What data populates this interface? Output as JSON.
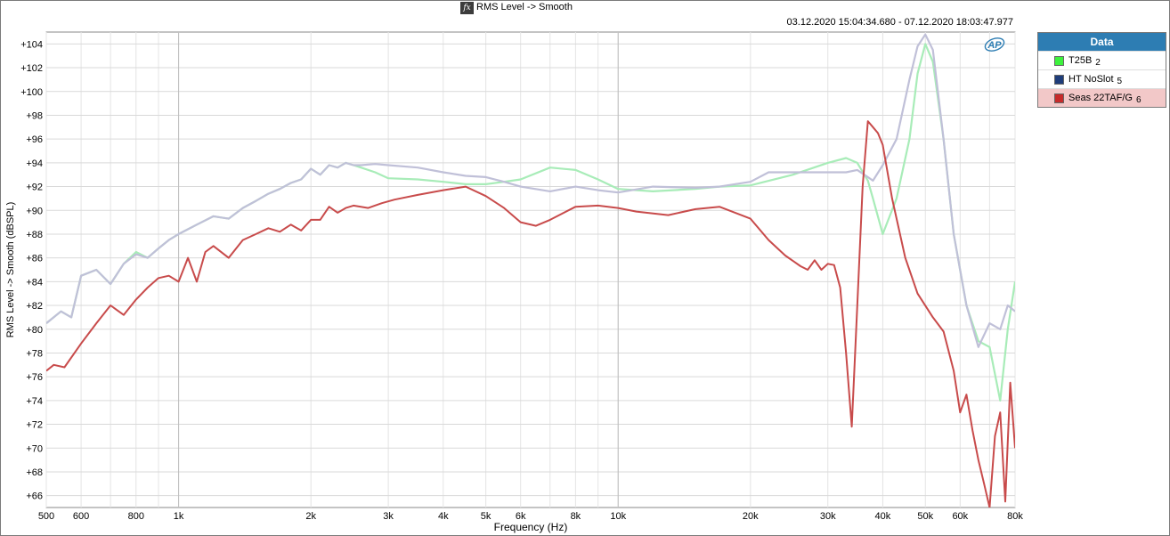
{
  "window": {
    "title": "RMS Level -> Smooth",
    "timestamp": "03.12.2020 15:04:34.680 - 07.12.2020 18:03:47.977"
  },
  "logo": {
    "text": "AP"
  },
  "legend": {
    "header": "Data",
    "items": [
      {
        "label": "T25B",
        "num": "2",
        "color": "#3df23d",
        "selected": false
      },
      {
        "label": "HT NoSlot",
        "num": "5",
        "color": "#1f3d7a",
        "selected": false
      },
      {
        "label": "Seas 22TAF/G",
        "num": "6",
        "color": "#c62b2b",
        "selected": true
      }
    ]
  },
  "chart_data": {
    "type": "line",
    "title": "RMS Level -> Smooth",
    "xlabel": "Frequency (Hz)",
    "ylabel": "RMS Level -> Smooth (dBSPL)",
    "xscale": "log",
    "xlim": [
      500,
      80000
    ],
    "ylim": [
      65,
      105
    ],
    "grid": true,
    "legend_position": "right",
    "x_ticks": [
      {
        "v": 500,
        "label": "500"
      },
      {
        "v": 600,
        "label": "600"
      },
      {
        "v": 800,
        "label": "800"
      },
      {
        "v": 1000,
        "label": "1k"
      },
      {
        "v": 2000,
        "label": "2k"
      },
      {
        "v": 3000,
        "label": "3k"
      },
      {
        "v": 4000,
        "label": "4k"
      },
      {
        "v": 5000,
        "label": "5k"
      },
      {
        "v": 6000,
        "label": "6k"
      },
      {
        "v": 8000,
        "label": "8k"
      },
      {
        "v": 10000,
        "label": "10k"
      },
      {
        "v": 20000,
        "label": "20k"
      },
      {
        "v": 30000,
        "label": "30k"
      },
      {
        "v": 40000,
        "label": "40k"
      },
      {
        "v": 50000,
        "label": "50k"
      },
      {
        "v": 60000,
        "label": "60k"
      },
      {
        "v": 80000,
        "label": "80k"
      }
    ],
    "y_ticks": [
      {
        "v": 66,
        "label": "+66"
      },
      {
        "v": 68,
        "label": "+68"
      },
      {
        "v": 70,
        "label": "+70"
      },
      {
        "v": 72,
        "label": "+72"
      },
      {
        "v": 74,
        "label": "+74"
      },
      {
        "v": 76,
        "label": "+76"
      },
      {
        "v": 78,
        "label": "+78"
      },
      {
        "v": 80,
        "label": "+80"
      },
      {
        "v": 82,
        "label": "+82"
      },
      {
        "v": 84,
        "label": "+84"
      },
      {
        "v": 86,
        "label": "+86"
      },
      {
        "v": 88,
        "label": "+88"
      },
      {
        "v": 90,
        "label": "+90"
      },
      {
        "v": 92,
        "label": "+92"
      },
      {
        "v": 94,
        "label": "+94"
      },
      {
        "v": 96,
        "label": "+96"
      },
      {
        "v": 98,
        "label": "+98"
      },
      {
        "v": 100,
        "label": "+100"
      },
      {
        "v": 102,
        "label": "+102"
      },
      {
        "v": 104,
        "label": "+104"
      }
    ],
    "series": [
      {
        "name": "T25B",
        "color": "#a8ecb8",
        "x": [
          500,
          540,
          570,
          600,
          650,
          700,
          750,
          800,
          850,
          900,
          950,
          1000,
          1100,
          1200,
          1300,
          1400,
          1500,
          1600,
          1700,
          1800,
          1900,
          2000,
          2100,
          2200,
          2300,
          2400,
          2500,
          2600,
          2800,
          3000,
          3500,
          4000,
          4500,
          5000,
          5500,
          6000,
          7000,
          8000,
          9000,
          10000,
          12000,
          15000,
          17000,
          20000,
          25000,
          30000,
          33000,
          35000,
          37000,
          38000,
          40000,
          43000,
          46000,
          48000,
          50000,
          52000,
          55000,
          58000,
          62000,
          66000,
          70000,
          74000,
          77000,
          80000
        ],
        "y": [
          80.5,
          81.5,
          81.0,
          84.5,
          85.0,
          83.8,
          85.5,
          86.5,
          86.0,
          86.8,
          87.5,
          88.0,
          88.8,
          89.5,
          89.3,
          90.2,
          90.8,
          91.4,
          91.8,
          92.3,
          92.6,
          93.5,
          93.0,
          93.8,
          93.6,
          94.0,
          93.8,
          93.6,
          93.2,
          92.7,
          92.6,
          92.4,
          92.2,
          92.2,
          92.4,
          92.6,
          93.6,
          93.4,
          92.6,
          91.8,
          91.6,
          91.8,
          92.0,
          92.1,
          93.0,
          94.0,
          94.4,
          94.0,
          92.5,
          91.0,
          88.0,
          91.0,
          96.0,
          101.5,
          104.0,
          102.5,
          96.0,
          88.0,
          82.0,
          79.0,
          78.5,
          74.0,
          80.0,
          84.0
        ]
      },
      {
        "name": "HT NoSlot",
        "color": "#c0c0d8",
        "x": [
          500,
          540,
          570,
          600,
          650,
          700,
          750,
          800,
          850,
          900,
          950,
          1000,
          1100,
          1200,
          1300,
          1400,
          1500,
          1600,
          1700,
          1800,
          1900,
          2000,
          2100,
          2200,
          2300,
          2400,
          2500,
          2600,
          2800,
          3000,
          3500,
          4000,
          4500,
          5000,
          5500,
          6000,
          7000,
          8000,
          9000,
          10000,
          12000,
          15000,
          17000,
          20000,
          22000,
          25000,
          30000,
          33000,
          35000,
          37000,
          38000,
          40000,
          43000,
          46000,
          48000,
          50000,
          52000,
          55000,
          58000,
          62000,
          66000,
          70000,
          74000,
          77000,
          80000
        ],
        "y": [
          80.5,
          81.5,
          81.0,
          84.5,
          85.0,
          83.8,
          85.5,
          86.3,
          86.0,
          86.8,
          87.5,
          88.0,
          88.8,
          89.5,
          89.3,
          90.2,
          90.8,
          91.4,
          91.8,
          92.3,
          92.6,
          93.5,
          93.0,
          93.8,
          93.6,
          94.0,
          93.8,
          93.8,
          93.9,
          93.8,
          93.6,
          93.2,
          92.9,
          92.8,
          92.4,
          92.0,
          91.6,
          92.0,
          91.7,
          91.5,
          92.0,
          91.9,
          92.0,
          92.4,
          93.2,
          93.2,
          93.2,
          93.2,
          93.4,
          92.8,
          92.5,
          93.8,
          96.0,
          101.0,
          103.8,
          104.8,
          103.5,
          96.0,
          88.0,
          82.0,
          78.5,
          80.5,
          80.0,
          82.0,
          81.5
        ]
      },
      {
        "name": "Seas 22TAF/G",
        "color": "#c84b4b",
        "x": [
          500,
          520,
          550,
          600,
          650,
          700,
          750,
          800,
          850,
          900,
          950,
          1000,
          1050,
          1100,
          1150,
          1200,
          1300,
          1400,
          1500,
          1600,
          1700,
          1800,
          1900,
          2000,
          2100,
          2200,
          2300,
          2400,
          2500,
          2700,
          2900,
          3100,
          3500,
          4000,
          4500,
          5000,
          5500,
          6000,
          6500,
          7000,
          8000,
          9000,
          10000,
          11000,
          13000,
          15000,
          17000,
          20000,
          22000,
          24000,
          26000,
          27000,
          28000,
          29000,
          30000,
          31000,
          32000,
          33000,
          34000,
          35000,
          36000,
          37000,
          38000,
          39000,
          40000,
          42000,
          45000,
          48000,
          52000,
          55000,
          58000,
          60000,
          62000,
          64000,
          66000,
          68000,
          70000,
          72000,
          74000,
          76000,
          78000,
          80000
        ],
        "y": [
          76.5,
          77.0,
          76.8,
          78.8,
          80.5,
          82.0,
          81.2,
          82.5,
          83.5,
          84.3,
          84.5,
          84.0,
          86.0,
          84.0,
          86.5,
          87.0,
          86.0,
          87.5,
          88.0,
          88.5,
          88.2,
          88.8,
          88.3,
          89.2,
          89.2,
          90.3,
          89.8,
          90.2,
          90.4,
          90.2,
          90.6,
          90.9,
          91.3,
          91.7,
          92.0,
          91.2,
          90.2,
          89.0,
          88.7,
          89.2,
          90.3,
          90.4,
          90.2,
          89.9,
          89.6,
          90.1,
          90.3,
          89.3,
          87.5,
          86.2,
          85.3,
          85.0,
          85.8,
          85.0,
          85.5,
          85.4,
          83.5,
          78.0,
          71.8,
          82.0,
          92.0,
          97.5,
          97.0,
          96.5,
          95.5,
          91.0,
          86.0,
          83.0,
          81.0,
          79.8,
          76.5,
          73.0,
          74.5,
          71.5,
          69.0,
          67.0,
          65.0,
          71.0,
          73.0,
          65.5,
          75.5,
          70.0
        ]
      }
    ]
  }
}
